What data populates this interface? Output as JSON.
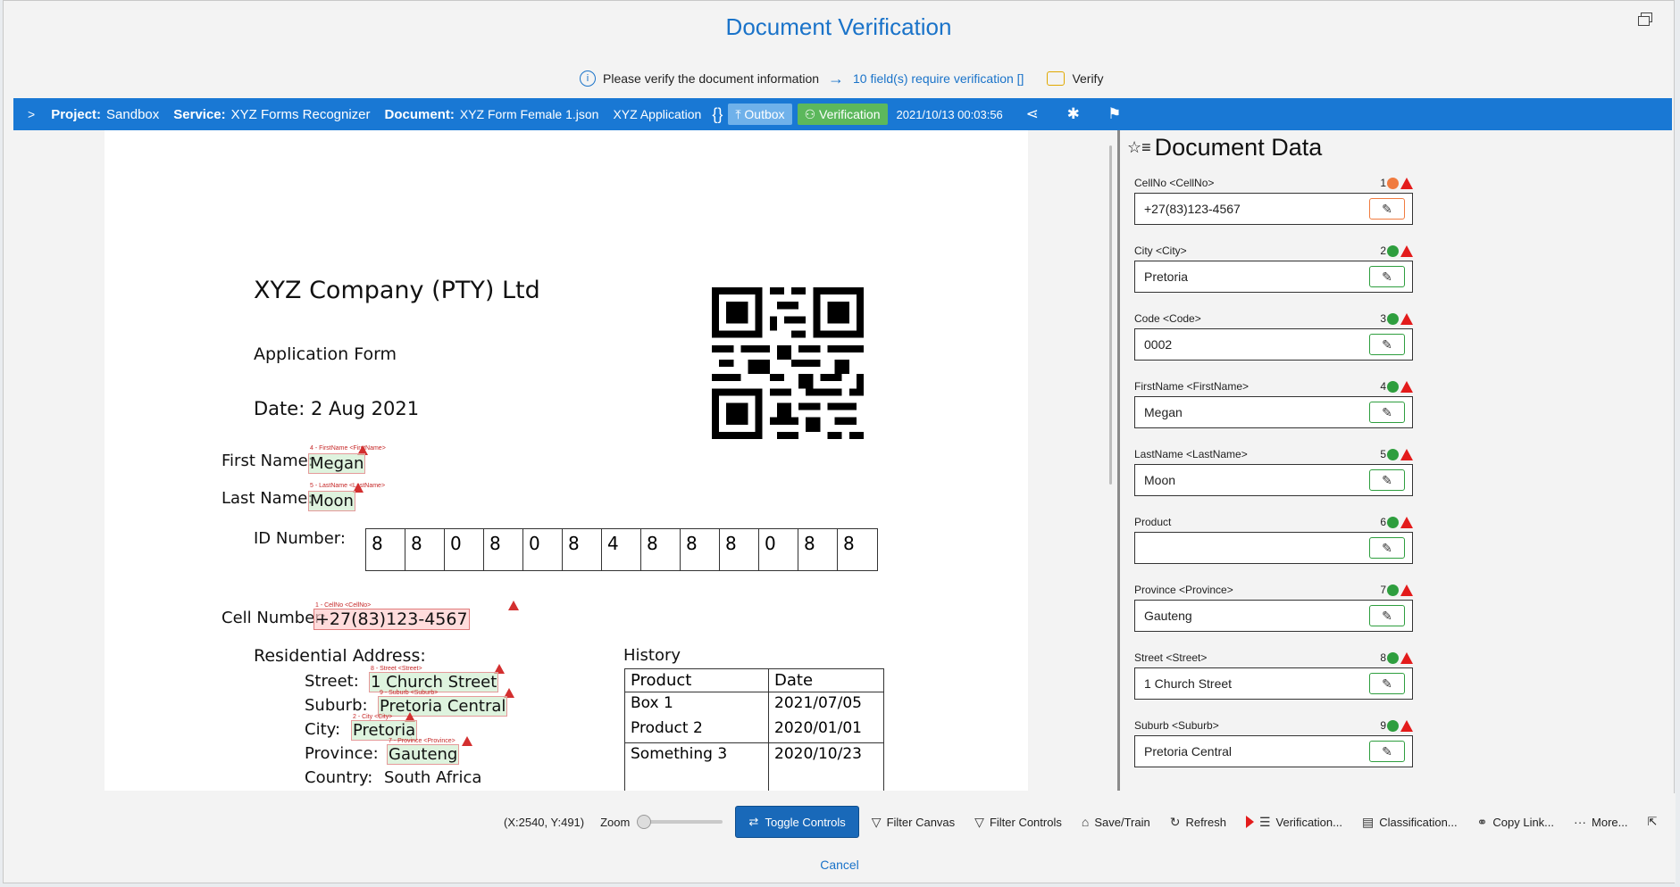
{
  "dialog": {
    "title": "Document Verification",
    "info_text": "Please verify the document information",
    "require_text": "10 field(s) require verification []",
    "verify_label": "Verify"
  },
  "infobar": {
    "project_label": "Project:",
    "project_value": "Sandbox",
    "service_label": "Service:",
    "service_value": "XYZ Forms Recognizer",
    "document_label": "Document:",
    "document_value": "XYZ Form Female 1.json",
    "application": "XYZ Application",
    "braces": "{}",
    "outbox_label": "Outbox",
    "verification_label": "Verification",
    "timestamp": "2021/10/13 00:03:56"
  },
  "document": {
    "company": "XYZ Company (PTY) Ltd",
    "form_title": "Application Form",
    "date": "Date: 2 Aug 2021",
    "first_name_label": "First Name:",
    "first_name": "Megan",
    "first_name_tag": "4 - FirstName <FirstName>",
    "last_name_label": "Last Name:",
    "last_name": "Moon",
    "last_name_tag": "5 - LastName <LastName>",
    "id_label": "ID Number:",
    "id_digits": [
      "8",
      "8",
      "0",
      "8",
      "0",
      "8",
      "4",
      "8",
      "8",
      "8",
      "0",
      "8",
      "8"
    ],
    "cell_label": "Cell Number:",
    "cell": "+27(83)123-4567",
    "cell_tag": "1 - CellNo <CellNo>",
    "address_label": "Residential Address:",
    "street_label": "Street:",
    "street": "1 Church Street",
    "street_tag": "8 - Street <Street>",
    "suburb_label": "Suburb:",
    "suburb": "Pretoria Central",
    "suburb_tag": "9 - Suburb <Suburb>",
    "city_label": "City:",
    "city": "Pretoria",
    "city_tag": "2 - City <City>",
    "province_label": "Province:",
    "province": "Gauteng",
    "province_tag": "7 - Province <Province>",
    "country_label": "Country:",
    "country": "South Africa",
    "history_title": "History",
    "history_headers": [
      "Product",
      "Date"
    ],
    "history_rows": [
      [
        "Box 1",
        "2021/07/05"
      ],
      [
        "Product 2",
        "2020/01/01"
      ],
      [
        "Something 3",
        "2020/10/23"
      ],
      [
        "",
        ""
      ]
    ]
  },
  "panel": {
    "title": "Document Data",
    "fields": [
      {
        "label": "CellNo <CellNo>",
        "num": "1",
        "value": "+27(83)123-4567",
        "status": "orange"
      },
      {
        "label": "City <City>",
        "num": "2",
        "value": "Pretoria",
        "status": "green"
      },
      {
        "label": "Code <Code>",
        "num": "3",
        "value": "0002",
        "status": "green"
      },
      {
        "label": "FirstName <FirstName>",
        "num": "4",
        "value": "Megan",
        "status": "green"
      },
      {
        "label": "LastName <LastName>",
        "num": "5",
        "value": "Moon",
        "status": "green"
      },
      {
        "label": "Product",
        "num": "6",
        "value": "",
        "status": "green"
      },
      {
        "label": "Province <Province>",
        "num": "7",
        "value": "Gauteng",
        "status": "green"
      },
      {
        "label": "Street <Street>",
        "num": "8",
        "value": "1 Church Street",
        "status": "green"
      },
      {
        "label": "Suburb <Suburb>",
        "num": "9",
        "value": "Pretoria Central",
        "status": "green"
      }
    ]
  },
  "toolbar": {
    "coords": "(X:2540, Y:491)",
    "zoom_label": "Zoom",
    "zoom_level": 0,
    "toggle_controls": "Toggle Controls",
    "filter_canvas": "Filter Canvas",
    "filter_controls": "Filter Controls",
    "save_train": "Save/Train",
    "refresh": "Refresh",
    "verification": "Verification...",
    "classification": "Classification...",
    "copy_link": "Copy Link...",
    "more": "More...",
    "cancel": "Cancel"
  },
  "colors": {
    "accent": "#1a73c9",
    "bar": "#1978d4",
    "ok": "#2e9e3e",
    "pending": "#f07b3f",
    "warning": "#e31b1b"
  }
}
